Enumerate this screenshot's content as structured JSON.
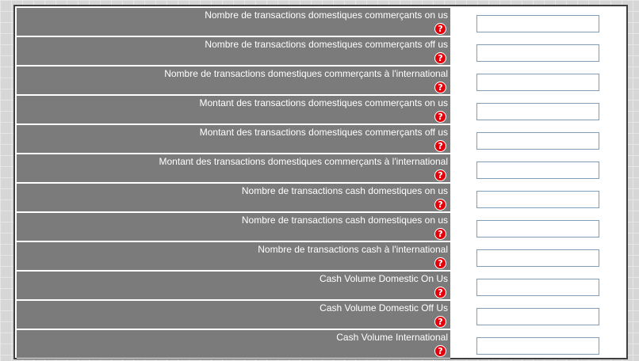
{
  "form": {
    "help_glyph": "?",
    "rows": [
      {
        "label": "Nombre de transactions domestiques commerçants on us",
        "value": ""
      },
      {
        "label": "Nombre de transactions domestiques commerçants off us",
        "value": ""
      },
      {
        "label": "Nombre de transactions domestiques commerçants à l'international",
        "value": ""
      },
      {
        "label": "Montant des transactions domestiques commerçants on us",
        "value": ""
      },
      {
        "label": "Montant des transactions domestiques commerçants off us",
        "value": ""
      },
      {
        "label": "Montant des transactions domestiques commerçants à l'international",
        "value": ""
      },
      {
        "label": "Nombre de transactions cash domestiques on us",
        "value": ""
      },
      {
        "label": "Nombre de transactions cash domestiques on us",
        "value": ""
      },
      {
        "label": "Nombre de transactions cash à l'international",
        "value": ""
      },
      {
        "label": "Cash Volume Domestic On Us",
        "value": ""
      },
      {
        "label": "Cash Volume Domestic Off Us",
        "value": ""
      },
      {
        "label": "Cash Volume International",
        "value": ""
      }
    ]
  },
  "colors": {
    "label_background": "#7b7b7b",
    "help_icon": "#e3000b",
    "field_border": "#7f9db9"
  }
}
